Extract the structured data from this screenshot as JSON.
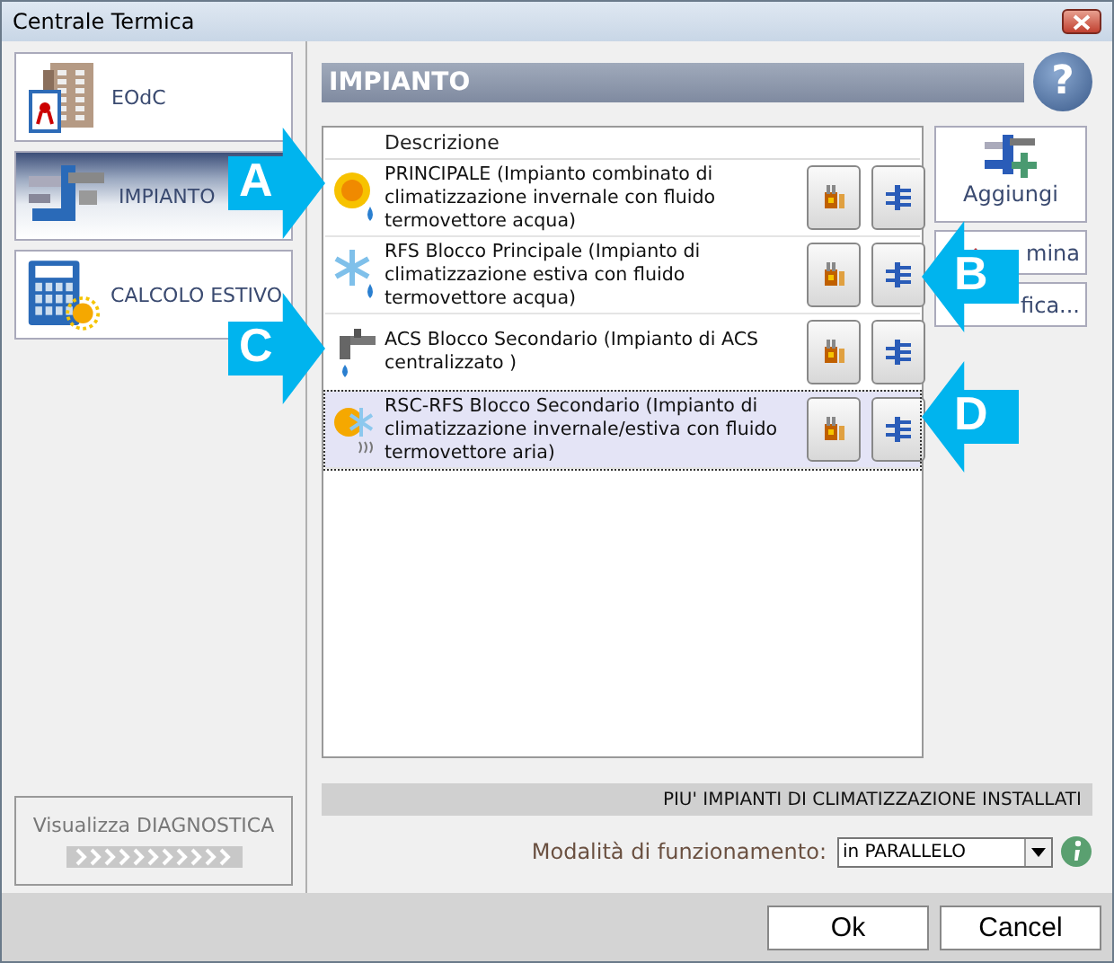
{
  "window": {
    "title": "Centrale Termica"
  },
  "nav": [
    {
      "label": "EOdC",
      "kind": "building",
      "selected": false
    },
    {
      "label": "IMPIANTO",
      "kind": "pipes",
      "selected": true
    },
    {
      "label": "CALCOLO ESTIVO",
      "kind": "calculator",
      "selected": false
    }
  ],
  "diagnostics_button": {
    "label": "Visualizza DIAGNOSTICA"
  },
  "section": {
    "title": "IMPIANTO",
    "help": "?"
  },
  "table": {
    "columns": [
      "Descrizione"
    ],
    "rows": [
      {
        "kind": "heating",
        "description": "PRINCIPALE (Impianto combinato di climatizzazione invernale con fluido termovettore acqua)",
        "selected": false
      },
      {
        "kind": "cooling",
        "description": "RFS Blocco Principale (Impianto di climatizzazione estiva con fluido termovettore acqua)",
        "selected": false
      },
      {
        "kind": "hot-water",
        "description": "ACS Blocco Secondario (Impianto di ACS centralizzato )",
        "selected": false
      },
      {
        "kind": "air",
        "description": "RSC-RFS Blocco Secondario (Impianto di climatizzazione invernale/estiva con fluido termovettore aria)",
        "selected": true
      }
    ]
  },
  "side_buttons": [
    "Aggiungi",
    "mina",
    "fica..."
  ],
  "info_bar": "PIU' IMPIANTI DI CLIMATIZZAZIONE INSTALLATI",
  "mode": {
    "label": "Modalità di funzionamento:",
    "value": "in PARALLELO"
  },
  "callouts": [
    {
      "letter": "A",
      "kind": "right"
    },
    {
      "letter": "B",
      "kind": "left"
    },
    {
      "letter": "C",
      "kind": "right"
    },
    {
      "letter": "D",
      "kind": "left"
    }
  ],
  "buttons": [
    "Ok",
    "Cancel"
  ]
}
